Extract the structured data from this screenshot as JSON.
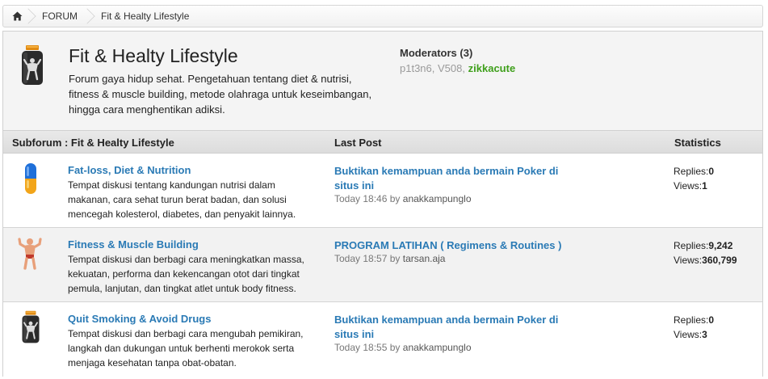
{
  "breadcrumb": {
    "home_icon": "home-icon",
    "items": [
      "FORUM",
      "Fit & Healty Lifestyle"
    ]
  },
  "forum": {
    "title": "Fit & Healty Lifestyle",
    "description": "Forum gaya hidup sehat. Pengetahuan tentang diet & nutrisi, fitness & muscle building, metode olahraga untuk keseimbangan, hingga cara menghentikan adiksi.",
    "icon": "bodybuilder-jar-icon"
  },
  "moderators": {
    "title": "Moderators (3)",
    "names": [
      "p1t3n6",
      "V508",
      "zikkacute"
    ],
    "separator": ","
  },
  "table": {
    "col_subforum": "Subforum : Fit & Healty Lifestyle",
    "col_lastpost": "Last Post",
    "col_stats": "Statistics"
  },
  "subforums": [
    {
      "icon": "capsule-icon",
      "title": "Fat-loss, Diet & Nutrition",
      "description": "Tempat diskusi tentang kandungan nutrisi dalam makanan, cara sehat turun berat badan, dan solusi mencegah kolesterol, diabetes, dan penyakit lainnya.",
      "last_post_title": "Buktikan kemampuan anda bermain Poker di situs ini",
      "last_post_time": "Today 18:46",
      "last_post_by": "by",
      "last_post_user": "anakkampunglo",
      "replies_label": "Replies:",
      "replies": "0",
      "views_label": "Views:",
      "views": "1"
    },
    {
      "icon": "muscleman-icon",
      "title": "Fitness & Muscle Building",
      "description": "Tempat diskusi dan berbagi cara meningkatkan massa, kekuatan, performa dan kekencangan otot dari tingkat pemula, lanjutan, dan tingkat atlet untuk body fitness.",
      "last_post_title": "PROGRAM LATIHAN ( Regimens & Routines )",
      "last_post_time": "Today 18:57",
      "last_post_by": "by",
      "last_post_user": "tarsan.aja",
      "replies_label": "Replies:",
      "replies": "9,242",
      "views_label": "Views:",
      "views": "360,799"
    },
    {
      "icon": "bodybuilder-jar-icon",
      "title": "Quit Smoking & Avoid Drugs",
      "description": "Tempat diskusi dan berbagi cara mengubah pemikiran, langkah dan dukungan untuk berhenti merokok serta menjaga kesehatan tanpa obat-obatan.",
      "last_post_title": "Buktikan kemampuan anda bermain Poker di situs ini",
      "last_post_time": "Today 18:55",
      "last_post_by": "by",
      "last_post_user": "anakkampunglo",
      "replies_label": "Replies:",
      "replies": "0",
      "views_label": "Views:",
      "views": "3"
    }
  ]
}
